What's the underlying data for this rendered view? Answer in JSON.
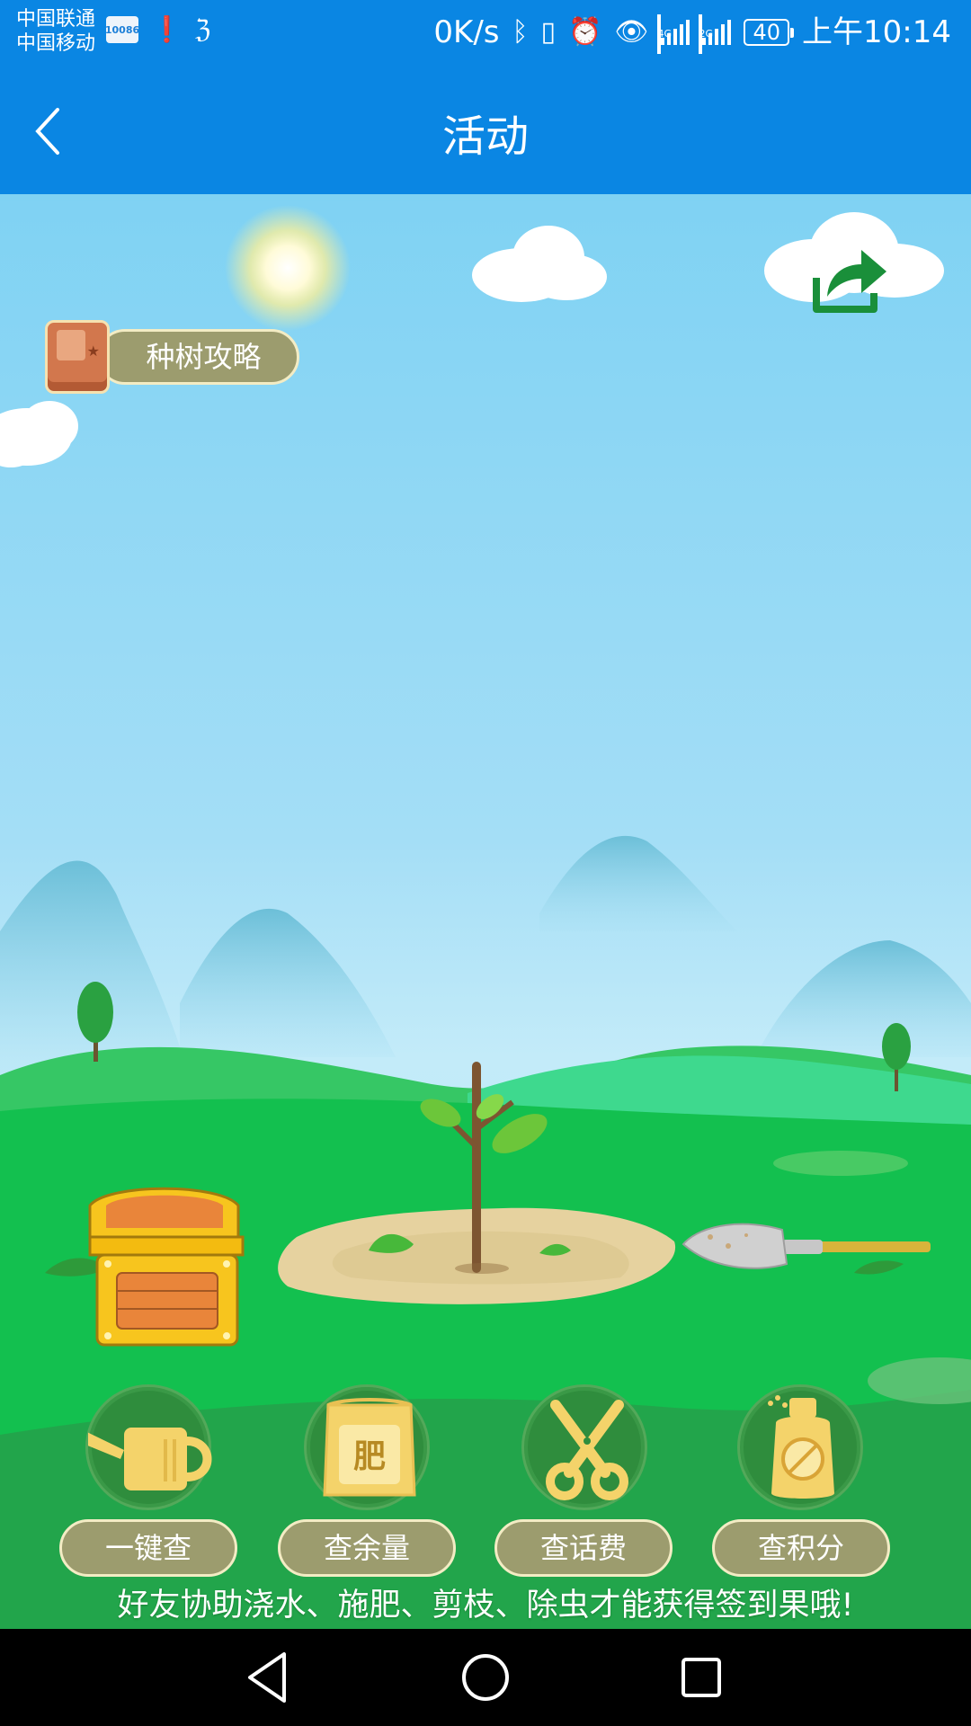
{
  "status_bar": {
    "carrier_1": "中国联通",
    "carrier_2": "中国移动",
    "chip_label": "10086",
    "net_speed": "0K/s",
    "signal_1_type": "4G",
    "signal_2_type": "2G",
    "battery": "40",
    "time": "上午10:14",
    "icons": [
      "sim-icon",
      "alert-icon",
      "app-icon",
      "bluetooth-icon",
      "vibrate-icon",
      "alarm-icon",
      "eye-icon",
      "signal-icon",
      "signal-icon",
      "battery-icon"
    ]
  },
  "header": {
    "title": "活动",
    "back_icon": "back-arrow-icon"
  },
  "game": {
    "guide_label": "种树攻略",
    "share_icon": "share-icon",
    "tools": [
      {
        "icon": "watering-can-icon",
        "label": "一键查"
      },
      {
        "icon": "fertilizer-bag-icon",
        "label": "查余量",
        "icon_text": "肥"
      },
      {
        "icon": "scissors-icon",
        "label": "查话费"
      },
      {
        "icon": "pesticide-bottle-icon",
        "label": "查积分"
      }
    ],
    "tip": "好友协助浇水、施肥、剪枝、除虫才能获得签到果哦!"
  },
  "colors": {
    "header_blue": "#0a86e3",
    "button_fill": "#9c9c6e",
    "button_border": "#f3ecc4",
    "tool_circle": "#2f8d3d",
    "grass": "#13c04f"
  }
}
